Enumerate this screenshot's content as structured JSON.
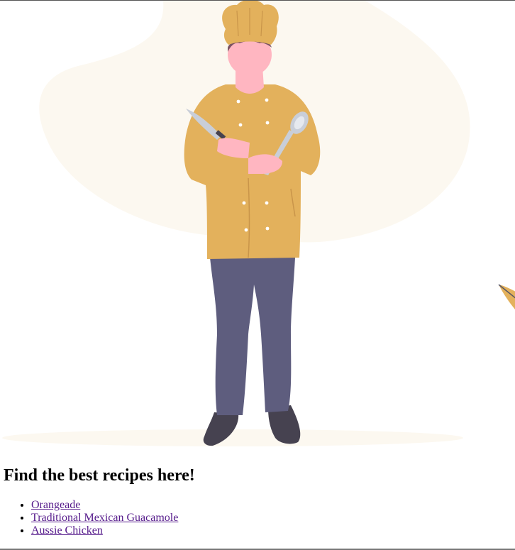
{
  "page": {
    "heading": "Find the best recipes here!"
  },
  "recipes": [
    {
      "label": "Orangeade"
    },
    {
      "label": "Traditional Mexican Guacamole"
    },
    {
      "label": "Aussie Chicken"
    }
  ],
  "illustration": {
    "subject": "chef-illustration",
    "colors": {
      "background_blob": "#fcf8f0",
      "jacket": "#e3b15c",
      "pants": "#5e5d7e",
      "shoes": "#464250",
      "skin": "#ffb6c1",
      "hair": "#7b5363",
      "utensil": "#c9ced8",
      "leaf": "#e3b15c"
    }
  }
}
